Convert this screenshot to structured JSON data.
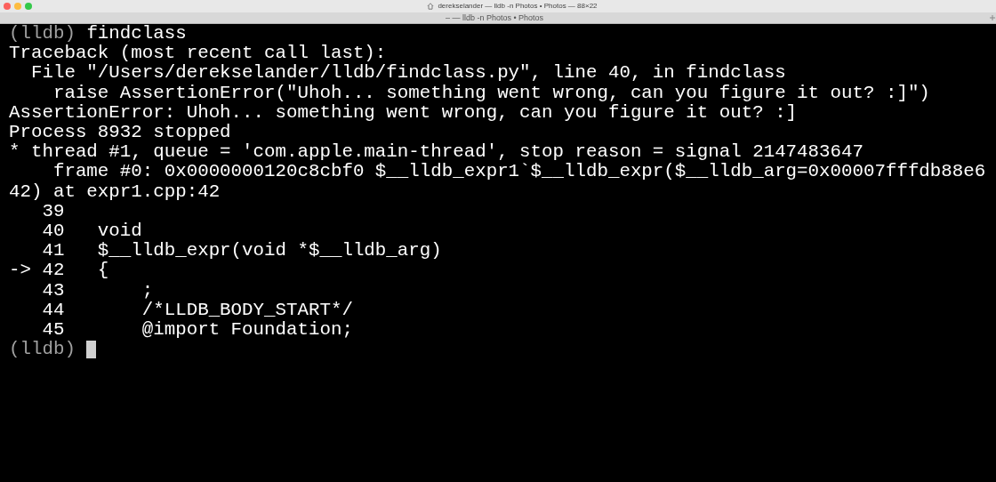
{
  "window": {
    "title": "derekselander — lldb -n Photos • Photos — 88×22"
  },
  "tab": {
    "label": "– — lldb -n Photos • Photos"
  },
  "lines": [
    {
      "kind": "prompt",
      "prompt": "(lldb)",
      "command": "findclass",
      "cursor": false
    },
    {
      "kind": "output",
      "text": "Traceback (most recent call last):"
    },
    {
      "kind": "output",
      "text": "  File \"/Users/derekselander/lldb/findclass.py\", line 40, in findclass"
    },
    {
      "kind": "output",
      "text": "    raise AssertionError(\"Uhoh... something went wrong, can you figure it out? :]\")"
    },
    {
      "kind": "output",
      "text": "AssertionError: Uhoh... something went wrong, can you figure it out? :]"
    },
    {
      "kind": "output",
      "text": "Process 8932 stopped"
    },
    {
      "kind": "output",
      "text": "* thread #1, queue = 'com.apple.main-thread', stop reason = signal 2147483647"
    },
    {
      "kind": "output",
      "text": "    frame #0: 0x0000000120c8cbf0 $__lldb_expr1`$__lldb_expr($__lldb_arg=0x00007fffdb88e6"
    },
    {
      "kind": "output",
      "text": "42) at expr1.cpp:42"
    },
    {
      "kind": "output",
      "text": "   39"
    },
    {
      "kind": "output",
      "text": "   40   void"
    },
    {
      "kind": "output",
      "text": "   41   $__lldb_expr(void *$__lldb_arg)"
    },
    {
      "kind": "output",
      "text": "-> 42   {"
    },
    {
      "kind": "output",
      "text": "   43       ;"
    },
    {
      "kind": "output",
      "text": "   44       /*LLDB_BODY_START*/"
    },
    {
      "kind": "output",
      "text": "   45       @import Foundation;"
    },
    {
      "kind": "prompt",
      "prompt": "(lldb)",
      "cursor": true
    }
  ]
}
